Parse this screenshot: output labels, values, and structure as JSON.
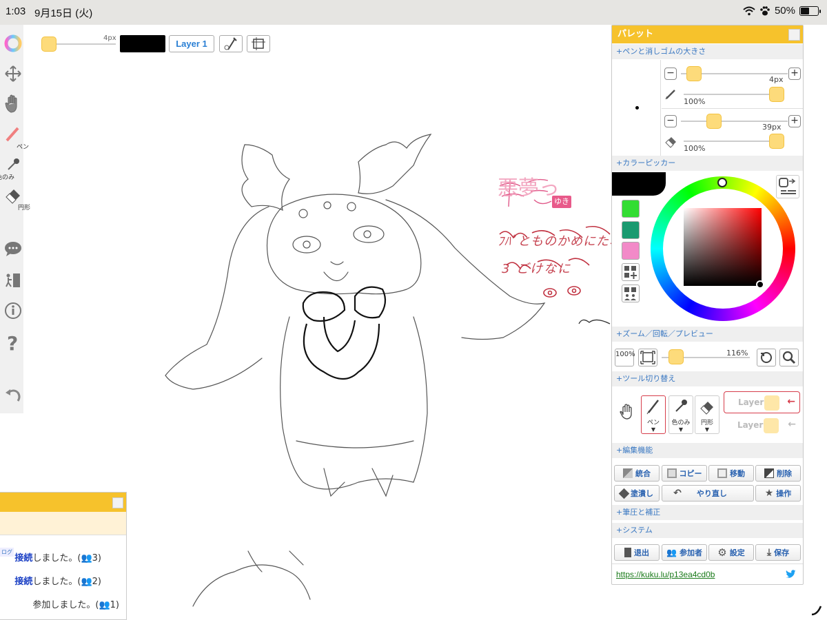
{
  "status": {
    "time": "1:03",
    "date": "9月15日 (火)",
    "battery": "50%",
    "battery_level": 0.5
  },
  "left_tools": {
    "pen_label": "ペン",
    "eyedropper_label": "色のみ",
    "shape_label": "円形"
  },
  "toolbar": {
    "brush_size": "4px",
    "layer_button": "Layer 1"
  },
  "canvas": {
    "annotation_text": "悪夢っ",
    "user_tag": "ゆき",
    "scribble_line1": "ﾌﾊﾟとものかめにたね",
    "scribble_line2": "3 ごけなに"
  },
  "palette": {
    "title": "パレット",
    "sections": {
      "pen_eraser_size": "+ペンと消しゴムの大きさ",
      "color_picker": "+カラーピッカー",
      "zoom": "+ズーム／回転／プレビュー",
      "tool_switch": "+ツール切り替え",
      "edit": "+編集機能",
      "pressure": "+筆圧と補正",
      "system": "+システム"
    },
    "pen": {
      "size": "4px",
      "opacity": "100%"
    },
    "eraser": {
      "size": "39px",
      "opacity": "100%"
    },
    "current_color": "#000000",
    "swatches": [
      "#33dd33",
      "#1a9a70",
      "#f28ac8"
    ],
    "zoom": {
      "reset_label": "100%",
      "value": "116%"
    },
    "tools": {
      "pen": "ペン",
      "eyedropper": "色のみ",
      "shape": "円形"
    },
    "layers": [
      "Layer1",
      "Layer2"
    ],
    "edit_buttons": {
      "merge": "統合",
      "copy": "コピー",
      "move": "移動",
      "delete": "削除",
      "fill": "塗潰し",
      "redo": "やり直し",
      "operate": "操作"
    },
    "system_buttons": {
      "exit": "退出",
      "members": "参加者",
      "settings": "設定",
      "save": "保存"
    },
    "room_link": "https://kuku.lu/p13ea4cd0b"
  },
  "chat": {
    "tag": "ログ",
    "messages": [
      {
        "bold": "接続",
        "text": "しました。(",
        "count": "3",
        "end": ")"
      },
      {
        "bold": "接続",
        "text": "しました。(",
        "count": "2",
        "end": ")"
      },
      {
        "bold": "",
        "text": "参加しました。(",
        "count": "1",
        "end": ")"
      }
    ]
  },
  "colors": {
    "accent": "#f6c22c",
    "link_blue": "#2a7fd4",
    "selected_red": "#d63c4a"
  }
}
